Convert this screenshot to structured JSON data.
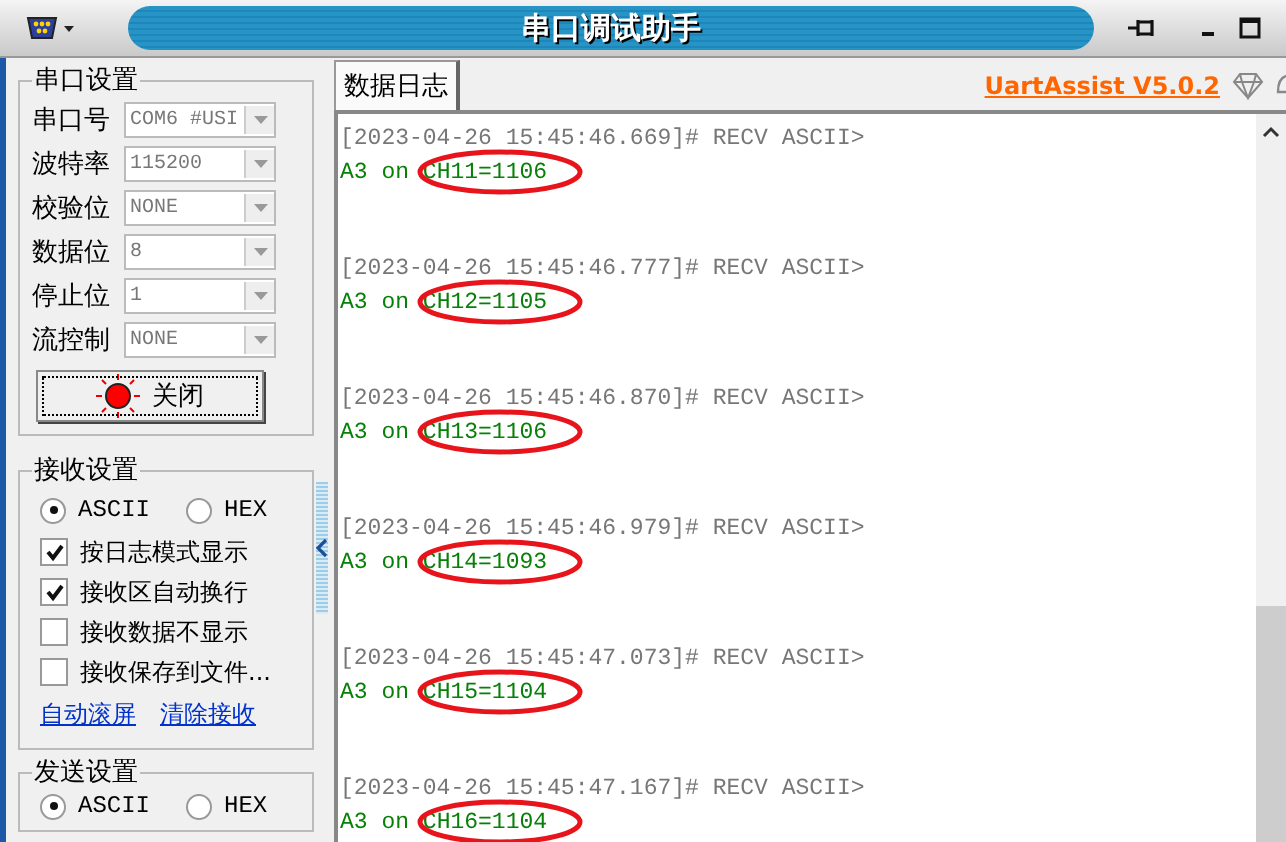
{
  "window": {
    "title": "串口调试助手"
  },
  "serial_settings": {
    "title": "串口设置",
    "fields": [
      {
        "label": "串口号",
        "value": "COM6 #USI"
      },
      {
        "label": "波特率",
        "value": "115200"
      },
      {
        "label": "校验位",
        "value": "NONE"
      },
      {
        "label": "数据位",
        "value": "8"
      },
      {
        "label": "停止位",
        "value": "1"
      },
      {
        "label": "流控制",
        "value": "NONE"
      }
    ],
    "port_button": {
      "label": "关闭",
      "open": true
    }
  },
  "receive_settings": {
    "title": "接收设置",
    "modes": [
      {
        "label": "ASCII",
        "selected": true
      },
      {
        "label": "HEX",
        "selected": false
      }
    ],
    "options": [
      {
        "label": "按日志模式显示",
        "checked": true
      },
      {
        "label": "接收区自动换行",
        "checked": true
      },
      {
        "label": "接收数据不显示",
        "checked": false
      },
      {
        "label": "接收保存到文件...",
        "checked": false
      }
    ],
    "links": [
      "自动滚屏",
      "清除接收"
    ]
  },
  "send_settings": {
    "title": "发送设置",
    "modes": [
      {
        "label": "ASCII",
        "selected": true
      },
      {
        "label": "HEX",
        "selected": false
      }
    ]
  },
  "tabs": [
    {
      "label": "数据日志",
      "selected": true
    }
  ],
  "app_link": "UartAssist V5.0.2",
  "log": [
    {
      "header": "[2023-04-26 15:45:46.669]# RECV ASCII>",
      "prefix": "A3 on ",
      "value": "CH11=1106",
      "circled": true
    },
    {
      "header": "[2023-04-26 15:45:46.777]# RECV ASCII>",
      "prefix": "A3 on ",
      "value": "CH12=1105",
      "circled": true
    },
    {
      "header": "[2023-04-26 15:45:46.870]# RECV ASCII>",
      "prefix": "A3 on ",
      "value": "CH13=1106",
      "circled": true
    },
    {
      "header": "[2023-04-26 15:45:46.979]# RECV ASCII>",
      "prefix": "A3 on ",
      "value": "CH14=1093",
      "circled": true
    },
    {
      "header": "[2023-04-26 15:45:47.073]# RECV ASCII>",
      "prefix": "A3 on ",
      "value": "CH15=1104",
      "circled": true
    },
    {
      "header": "[2023-04-26 15:45:47.167]# RECV ASCII>",
      "prefix": "A3 on ",
      "value": "CH16=1104",
      "circled": true
    }
  ]
}
